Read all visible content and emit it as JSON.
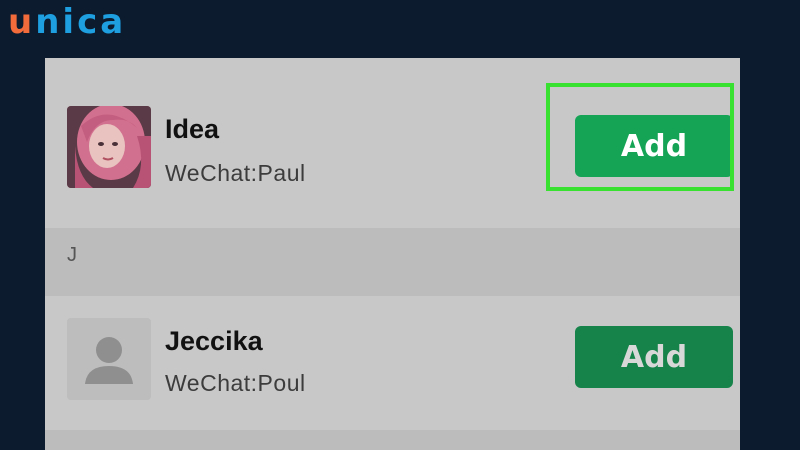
{
  "brand": {
    "logo_first": "u",
    "logo_rest": "nica",
    "first_color": "#f26b3a",
    "rest_color": "#1d9fe0"
  },
  "contacts": [
    {
      "name": "Idea",
      "wechat_id": "WeChat:Paul",
      "button_label": "Add",
      "avatar": "pink-hair-girl-photo",
      "highlighted": true
    },
    {
      "name": "Jeccika",
      "wechat_id": "WeChat:Poul",
      "button_label": "Add",
      "avatar": "default-person-silhouette-icon",
      "highlighted": false
    }
  ],
  "section_header": "J",
  "colors": {
    "add_button": "#15a356",
    "highlight_border": "#38e030",
    "background": "#0d1b2e"
  }
}
